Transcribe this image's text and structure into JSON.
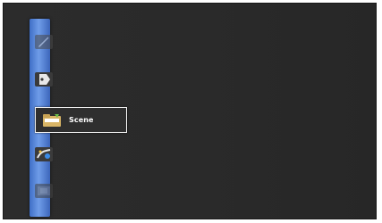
{
  "menu": {
    "items": [
      {
        "icon": "edit-icon",
        "label": "",
        "selected": false
      },
      {
        "icon": "tag-icon",
        "label": "",
        "selected": false
      },
      {
        "icon": "folder-icon",
        "label": "Scene",
        "selected": true
      },
      {
        "icon": "magic-icon",
        "label": "",
        "selected": false
      },
      {
        "icon": "film-icon",
        "label": "",
        "selected": false
      }
    ]
  },
  "colors": {
    "sidebar": "#5a88dc",
    "background": "#2a2a2a",
    "highlight_border": "#f0f0f0"
  }
}
